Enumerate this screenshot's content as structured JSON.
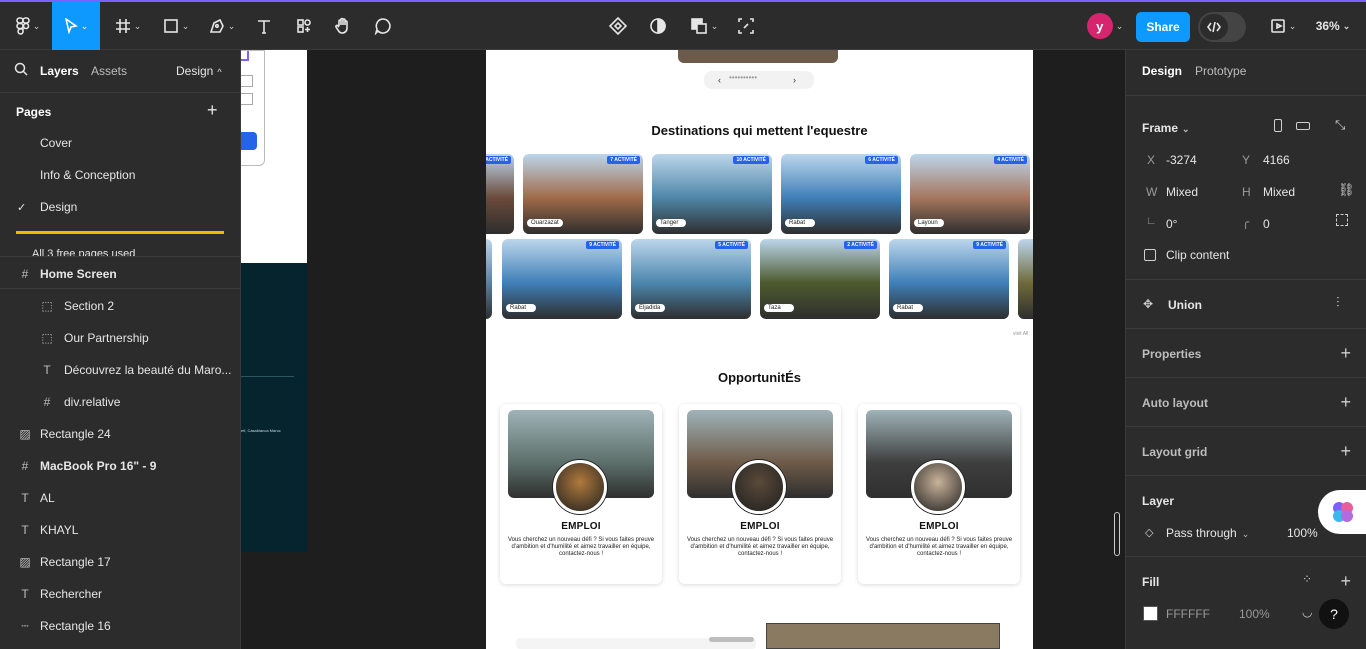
{
  "topbar": {
    "share_label": "Share",
    "zoom_label": "36%",
    "avatar_initial": "y"
  },
  "left": {
    "tabs": {
      "layers": "Layers",
      "assets": "Assets",
      "design": "Design"
    },
    "pages_title": "Pages",
    "pages": [
      "Cover",
      "Info & Conception",
      "Design"
    ],
    "active_page": "Design",
    "notice": "All 3 free pages used",
    "layers": [
      {
        "name": "Home Screen",
        "type": "frame",
        "bold": true,
        "indent": 0
      },
      {
        "name": "Section 2",
        "type": "section",
        "bold": false,
        "indent": 1
      },
      {
        "name": "Our Partnership",
        "type": "section",
        "bold": false,
        "indent": 1
      },
      {
        "name": "Découvrez la beauté du Maro...",
        "type": "text",
        "bold": false,
        "indent": 1
      },
      {
        "name": "div.relative",
        "type": "frame",
        "bold": false,
        "indent": 1
      },
      {
        "name": "Rectangle 24",
        "type": "image",
        "bold": false,
        "indent": 0
      },
      {
        "name": "MacBook Pro 16\" - 9",
        "type": "frame",
        "bold": true,
        "indent": 0
      },
      {
        "name": "AL",
        "type": "text",
        "bold": false,
        "indent": 0
      },
      {
        "name": "KHAYL",
        "type": "text",
        "bold": false,
        "indent": 0
      },
      {
        "name": "Rectangle 17",
        "type": "image",
        "bold": false,
        "indent": 0
      },
      {
        "name": "Rechercher",
        "type": "text",
        "bold": false,
        "indent": 0
      },
      {
        "name": "Rectangle 16",
        "type": "line",
        "bold": false,
        "indent": 0
      }
    ]
  },
  "canvas": {
    "left_frame_footer": "elf, Casablanca Maroc",
    "dest_title": "Destinations qui mettent l'equestre",
    "visit_all": "visit All",
    "row1": [
      {
        "city": "",
        "badge": "ACTIVITÉ",
        "color": "#6b4a3a"
      },
      {
        "city": "Ouarzazat",
        "badge": "7 ACTIVITÉ",
        "color": "#a06a48"
      },
      {
        "city": "Tanger",
        "badge": "10 ACTIVITÉ",
        "color": "#4f86a8"
      },
      {
        "city": "Rabat",
        "badge": "6 ACTIVITÉ",
        "color": "#3f7fb8"
      },
      {
        "city": "Layoun",
        "badge": "4 ACTIVITÉ",
        "color": "#a6765e"
      }
    ],
    "row2": [
      {
        "city": "",
        "badge": "",
        "color": "#5a7fa0"
      },
      {
        "city": "Rabat",
        "badge": "9 ACTIVITÉ",
        "color": "#3f7fb8"
      },
      {
        "city": "Eljadida",
        "badge": "5 ACTIVITÉ",
        "color": "#4c86ad"
      },
      {
        "city": "Taza",
        "badge": "2 ACTIVITÉ",
        "color": "#4d5a2e"
      },
      {
        "city": "Rabat",
        "badge": "9 ACTIVITÉ",
        "color": "#3f7fb8"
      },
      {
        "city": "",
        "badge": "",
        "color": "#6f6a3a"
      }
    ],
    "opp_title": "OpportunitÉs",
    "opps": [
      {
        "title": "EMPLOI",
        "desc": "Vous cherchez un nouveau défi ? Si vous faites preuve d'ambition et d'humilité et aimez travailler en équipe, contactez-nous !",
        "img": "#5c6f6a",
        "av": "#b07a3c"
      },
      {
        "title": "EMPLOI",
        "desc": "Vous cherchez un nouveau défi ? Si vous faites preuve d'ambition et d'humilité et aimez travailler en équipe, contactez-nous !",
        "img": "#6e5a48",
        "av": "#5a4a3a"
      },
      {
        "title": "EMPLOI",
        "desc": "Vous cherchez un nouveau défi ? Si vous faites preuve d'ambition et d'humilité et aimez travailler en équipe, contactez-nous !",
        "img": "#3e3e3e",
        "av": "#c9b39a"
      }
    ]
  },
  "right": {
    "tabs": {
      "design": "Design",
      "prototype": "Prototype"
    },
    "frame_label": "Frame",
    "x_label": "X",
    "x_value": "-3274",
    "y_label": "Y",
    "y_value": "4166",
    "w_label": "W",
    "w_value": "Mixed",
    "h_label": "H",
    "h_value": "Mixed",
    "rotation": "0°",
    "radius": "0",
    "clip_label": "Clip content",
    "union_label": "Union",
    "properties": "Properties",
    "auto_layout": "Auto layout",
    "layout_grid": "Layout grid",
    "layer_title": "Layer",
    "blend": "Pass through",
    "opacity": "100%",
    "fill_title": "Fill",
    "fill_hex": "FFFFFF",
    "fill_opacity": "100%",
    "help": "?"
  },
  "colors": {
    "accent": "#0d99ff",
    "purple": "#7b61ff",
    "notice": "#f5b800",
    "dark_teal": "#06242e"
  }
}
